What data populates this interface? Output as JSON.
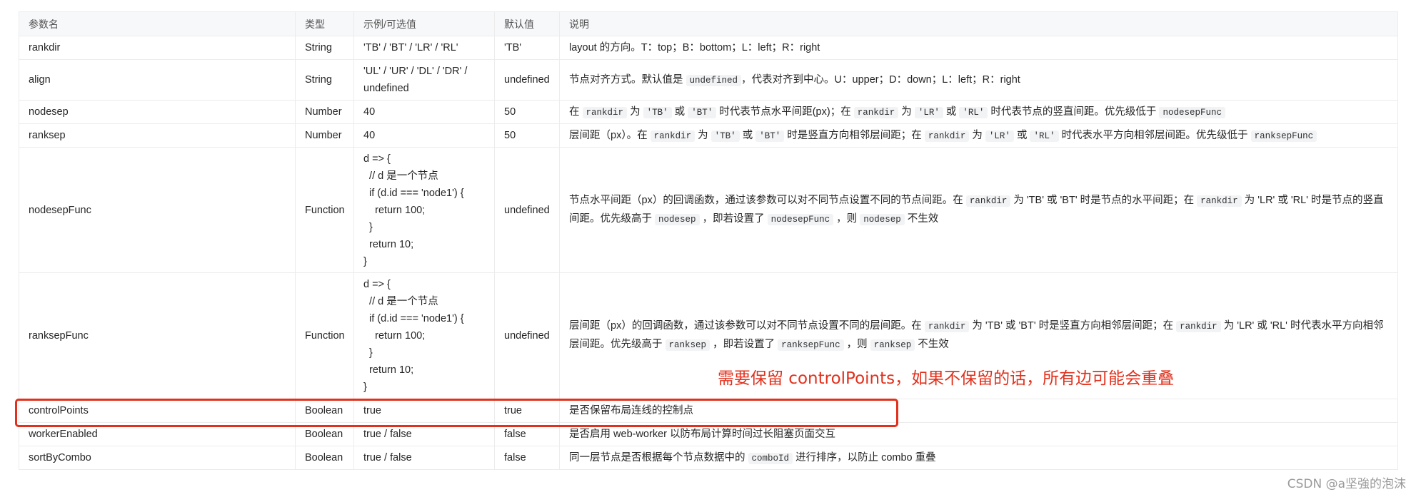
{
  "headers": {
    "name": "参数名",
    "type": "类型",
    "example": "示例/可选值",
    "default": "默认值",
    "desc": "说明"
  },
  "rows": {
    "rankdir": {
      "name": "rankdir",
      "type": "String",
      "example": "'TB' / 'BT' / 'LR' / 'RL'",
      "default": "'TB'",
      "desc": "layout 的方向。T：top；B：bottom；L：left；R：right"
    },
    "align": {
      "name": "align",
      "type": "String",
      "example_l1": "'UL' / 'UR' / 'DL' / 'DR' /",
      "example_l2": "undefined",
      "default": "undefined",
      "desc_a": "节点对齐方式。默认值是 ",
      "desc_code": "undefined",
      "desc_b": "，代表对齐到中心。U：upper；D：down；L：left；R：right"
    },
    "nodesep": {
      "name": "nodesep",
      "type": "Number",
      "example": "40",
      "default": "50",
      "d1": "在 ",
      "c1": "rankdir",
      "d2": " 为 ",
      "c2": "'TB'",
      "d3": " 或 ",
      "c3": "'BT'",
      "d4": " 时代表节点水平间距(px)；在 ",
      "c4": "rankdir",
      "d5": " 为 ",
      "c5": "'LR'",
      "d6": " 或 ",
      "c6": "'RL'",
      "d7": " 时代表节点的竖直间距。优先级低于 ",
      "c7": "nodesepFunc"
    },
    "ranksep": {
      "name": "ranksep",
      "type": "Number",
      "example": "40",
      "default": "50",
      "d1": "层间距（px）。在 ",
      "c1": "rankdir",
      "d2": " 为 ",
      "c2": "'TB'",
      "d3": " 或 ",
      "c3": "'BT'",
      "d4": " 时是竖直方向相邻层间距；在 ",
      "c4": "rankdir",
      "d5": " 为 ",
      "c5": "'LR'",
      "d6": " 或 ",
      "c6": "'RL'",
      "d7": " 时代表水平方向相邻层间距。优先级低于 ",
      "c7": "ranksepFunc"
    },
    "nodesepFunc": {
      "name": "nodesepFunc",
      "type": "Function",
      "example": "d => {\n  // d 是一个节点\n  if (d.id === 'node1') {\n    return 100;\n  }\n  return 10;\n}",
      "default": "undefined",
      "d1": "节点水平间距（px）的回调函数，通过该参数可以对不同节点设置不同的节点间距。在 ",
      "c1": "rankdir",
      "d2": " 为 'TB' 或 'BT' 时是节点的水平间距；在 ",
      "c2": "rankdir",
      "d3": " 为 'LR' 或 'RL' 时是节点的竖直间距。优先级高于 ",
      "c3": "nodesep",
      "d4": " ，即若设置了 ",
      "c4": "nodesepFunc",
      "d5": " ，则 ",
      "c5": "nodesep",
      "d6": " 不生效"
    },
    "ranksepFunc": {
      "name": "ranksepFunc",
      "type": "Function",
      "example": "d => {\n  // d 是一个节点\n  if (d.id === 'node1') {\n    return 100;\n  }\n  return 10;\n}",
      "default": "undefined",
      "d1": "层间距（px）的回调函数，通过该参数可以对不同节点设置不同的层间距。在 ",
      "c1": "rankdir",
      "d2": " 为 'TB' 或 'BT' 时是竖直方向相邻层间距；在 ",
      "c2": "rankdir",
      "d3": " 为 'LR' 或 'RL' 时代表水平方向相邻层间距。优先级高于 ",
      "c3": "ranksep",
      "d4": " ，即若设置了 ",
      "c4": "ranksepFunc",
      "d5": " ，则 ",
      "c5": "ranksep",
      "d6": " 不生效"
    },
    "controlPoints": {
      "name": "controlPoints",
      "type": "Boolean",
      "example": "true",
      "default": "true",
      "desc": "是否保留布局连线的控制点"
    },
    "workerEnabled": {
      "name": "workerEnabled",
      "type": "Boolean",
      "example": "true / false",
      "default": "false",
      "desc": "是否启用 web-worker 以防布局计算时间过长阻塞页面交互"
    },
    "sortByCombo": {
      "name": "sortByCombo",
      "type": "Boolean",
      "example": "true / false",
      "default": "false",
      "d1": "同一层节点是否根据每个节点数据中的 ",
      "c1": "comboId",
      "d2": " 进行排序，以防止 combo 重叠"
    }
  },
  "annotation": "需要保留 controlPoints，如果不保留的话，所有边可能会重叠",
  "watermark": "CSDN @a坚強的泡沫",
  "colors": {
    "annotation": "#e2301c",
    "header_bg": "#f7f8fa",
    "border": "#ececec"
  }
}
